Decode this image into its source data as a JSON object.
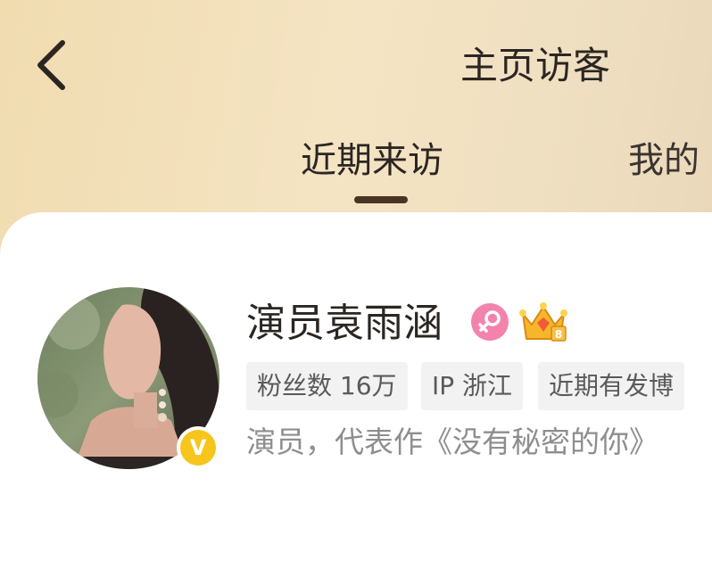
{
  "header": {
    "title": "主页访客",
    "back_icon": "chevron-left-icon"
  },
  "tabs": [
    {
      "label": "近期来访",
      "active": true
    },
    {
      "label": "我的访客",
      "visible_text": "我的",
      "active": false
    }
  ],
  "visitors": [
    {
      "name": "演员袁雨涵",
      "avatar": "profile-photo",
      "verified_badge": "V",
      "gender": "female",
      "tags": [
        "粉丝数 16万",
        "IP 浙江",
        "近期有发博"
      ],
      "bio": "演员，代表作《没有秘密的你》"
    }
  ],
  "colors": {
    "header_gradient_start": "#f1dcb0",
    "header_gradient_end": "#e9d6b8",
    "tab_indicator": "#4a3524",
    "verified_badge": "#f7c51b",
    "gender_icon_bg": "#f383ad",
    "tag_bg": "#f2f2f2",
    "bio_text": "#8e8e8e"
  }
}
